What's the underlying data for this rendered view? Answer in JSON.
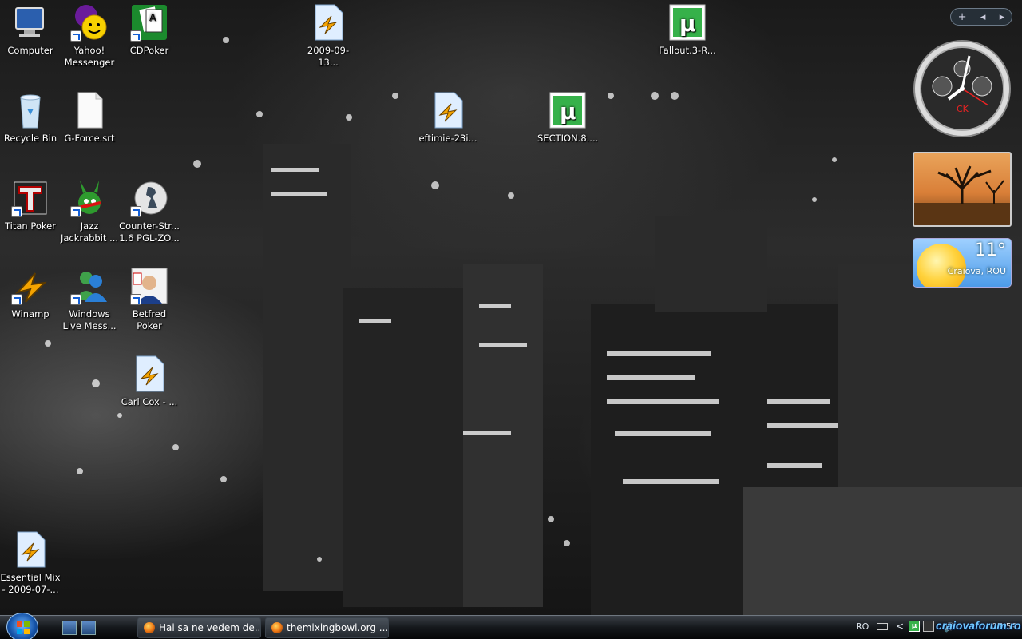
{
  "desktop": {
    "icons": [
      {
        "label": "Computer",
        "icon": "computer-icon"
      },
      {
        "label": "Yahoo! Messenger",
        "icon": "yahoo-messenger-icon"
      },
      {
        "label": "CDPoker",
        "icon": "poker-cards-icon"
      },
      {
        "label": "2009-09-13...",
        "icon": "winamp-media-file-icon"
      },
      {
        "label": "Fallout.3-R...",
        "icon": "utorrent-file-icon"
      },
      {
        "label": "Recycle Bin",
        "icon": "recycle-bin-icon"
      },
      {
        "label": "G-Force.srt",
        "icon": "text-file-icon"
      },
      {
        "label": "eftimie-23i...",
        "icon": "winamp-media-file-icon"
      },
      {
        "label": "SECTION.8....",
        "icon": "utorrent-file-icon"
      },
      {
        "label": "Titan Poker",
        "icon": "titan-poker-icon"
      },
      {
        "label": "Jazz Jackrabbit ...",
        "icon": "jazz-jackrabbit-icon"
      },
      {
        "label": "Counter-Str... 1.6 PGL-ZO...",
        "icon": "counter-strike-icon"
      },
      {
        "label": "Winamp",
        "icon": "winamp-icon"
      },
      {
        "label": "Windows Live Mess...",
        "icon": "windows-live-messenger-icon"
      },
      {
        "label": "Betfred Poker",
        "icon": "betfred-poker-icon"
      },
      {
        "label": "Carl Cox - ...",
        "icon": "winamp-media-file-icon"
      },
      {
        "label": "Essential Mix - 2009-07-...",
        "icon": "winamp-media-file-icon"
      }
    ]
  },
  "sidebar": {
    "controls": {
      "add": "+",
      "prev": "◂",
      "next": "▸"
    },
    "clock": {
      "brand": "CK"
    },
    "weather": {
      "temperature": "11°",
      "location": "Craiova, ROU"
    }
  },
  "taskbar": {
    "tasks": [
      {
        "label": "Hai sa ne vedem de..."
      },
      {
        "label": "themixingbowl.org ..."
      }
    ],
    "tray": {
      "language": "RO",
      "chevron": "<",
      "utorrent": "µ",
      "clock": "07:59"
    }
  },
  "watermark": "craiovaforum.ro",
  "colors": {
    "utorrent_green": "#36b14a",
    "taskbar_dark": "#15181c",
    "weather_blue": "#4c9be8"
  }
}
